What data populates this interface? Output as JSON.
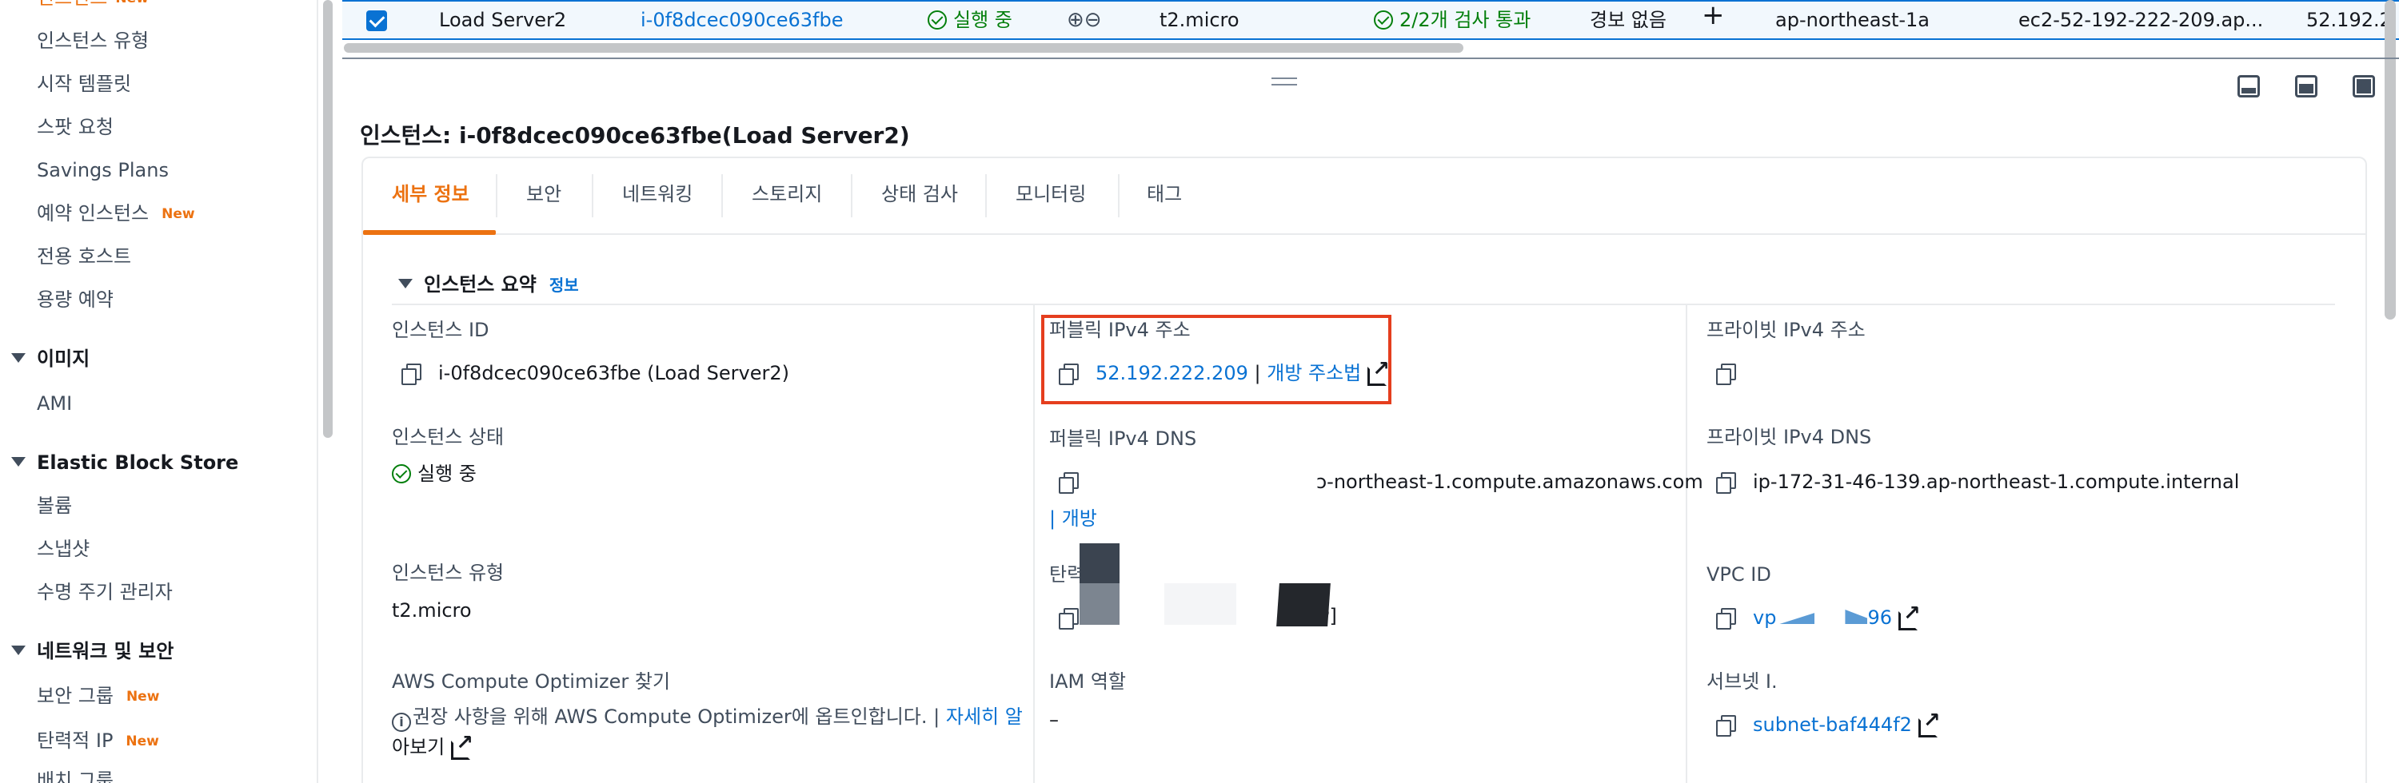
{
  "sidebar": {
    "items": [
      {
        "label": "인스턴스 유형"
      },
      {
        "label": "시작 템플릿"
      },
      {
        "label": "스팟 요청"
      },
      {
        "label": "Savings Plans"
      },
      {
        "label": "예약 인스턴스",
        "badge": "New"
      },
      {
        "label": "전용 호스트"
      },
      {
        "label": "용량 예약"
      }
    ],
    "sections": [
      {
        "label": "이미지",
        "items": [
          {
            "label": "AMI"
          }
        ]
      },
      {
        "label": "Elastic Block Store",
        "items": [
          {
            "label": "볼륨"
          },
          {
            "label": "스냅샷"
          },
          {
            "label": "수명 주기 관리자"
          }
        ]
      },
      {
        "label": "네트워크 및 보안",
        "items": [
          {
            "label": "보안 그룹",
            "badge": "New"
          },
          {
            "label": "탄력적 IP",
            "badge": "New"
          }
        ]
      }
    ]
  },
  "table_row": {
    "name": "Load Server2",
    "instance_id": "i-0f8dcec090ce63fbe",
    "state": "실행 중",
    "type": "t2.micro",
    "status_check": "2/2개 검사 통과",
    "alarm": "경보 없음",
    "az": "ap-northeast-1a",
    "public_dns": "ec2-52-192-222-209.ap...",
    "public_ip": "52.192.2"
  },
  "detail": {
    "title": "인스턴스: i-0f8dcec090ce63fbe(Load Server2)",
    "tabs": [
      "세부 정보",
      "보안",
      "네트워킹",
      "스토리지",
      "상태 검사",
      "모니터링",
      "태그"
    ],
    "active_tab": "세부 정보",
    "summary": {
      "header": "인스턴스 요약",
      "info_link": "정보",
      "instance_id_label": "인스턴스 ID",
      "instance_id_value": "i-0f8dcec090ce63fbe (Load Server2)",
      "public_ipv4_label": "퍼블릭 IPv4 주소",
      "public_ipv4_value": "52.192.222.209",
      "public_ipv4_sep": "|",
      "open_address": "개방 주소법",
      "private_ipv4_label": "프라이빗 IPv4 주소",
      "instance_state_label": "인스턴스 상태",
      "instance_state_value": "실행 중",
      "public_dns_label": "퍼블릭 IPv4 DNS",
      "public_dns_value": "ɔ-northeast-1.compute.amazonaws.com",
      "public_dns_open": "| 개방",
      "private_dns_label": "프라이빗 IPv4 DNS",
      "private_dns_value": "ip-172-31-46-139.ap-northeast-1.compute.internal",
      "instance_type_label": "인스턴스 유형",
      "instance_type_value": "t2.micro",
      "elastic_ip_label": "탄력",
      "elastic_ip_tail": "P]",
      "vpc_label": "VPC ID",
      "vpc_value_a": "vp",
      "vpc_value_b": "96",
      "optimizer_label": "AWS Compute Optimizer 찾기",
      "optimizer_text": "권장 사항을 위해 AWS Compute Optimizer에 옵트인합니다. |",
      "optimizer_link_a": "자세히 알",
      "optimizer_link_b": "아보기",
      "iam_label": "IAM 역할",
      "iam_value": "–",
      "subnet_label": "서브넷 I.",
      "subnet_value": "subnet-baf444f2"
    }
  },
  "colors": {
    "accent": "#ec7211",
    "link": "#0972d3",
    "success": "#037f0c",
    "highlight": "#e53e1e"
  }
}
